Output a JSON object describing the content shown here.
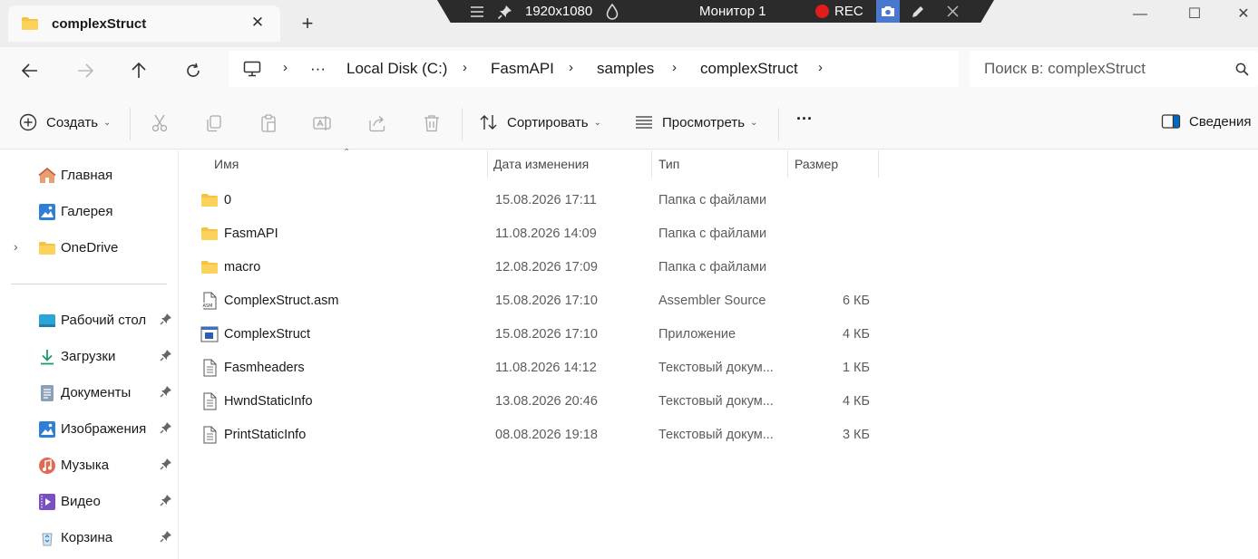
{
  "titlebar": {
    "tab_title": "complexStruct",
    "close_glyph": "✕",
    "new_tab_glyph": "+"
  },
  "overlay": {
    "resolution": "1920x1080",
    "monitor": "Монитор 1",
    "rec": "REC"
  },
  "window_controls": {
    "minimize": "—",
    "maximize": "☐",
    "close": "✕"
  },
  "address": {
    "more": "···",
    "crumbs": [
      "Local Disk (C:)",
      "FasmAPI",
      "samples",
      "complexStruct"
    ],
    "separator": "›"
  },
  "search": {
    "placeholder": "Поиск в: complexStruct"
  },
  "toolbar": {
    "new_label": "Создать",
    "sort_label": "Сортировать",
    "view_label": "Просмотреть",
    "more_label": "···",
    "details_label": "Сведения",
    "caret": "⌄"
  },
  "sidebar": {
    "items": [
      {
        "label": "Главная",
        "icon": "home-icon"
      },
      {
        "label": "Галерея",
        "icon": "gallery-icon"
      },
      {
        "label": "OneDrive",
        "icon": "folder-icon"
      },
      {
        "label": "Рабочий стол",
        "icon": "desktop-icon"
      },
      {
        "label": "Загрузки",
        "icon": "download-icon"
      },
      {
        "label": "Документы",
        "icon": "documents-icon"
      },
      {
        "label": "Изображения",
        "icon": "pictures-icon"
      },
      {
        "label": "Музыка",
        "icon": "music-icon"
      },
      {
        "label": "Видео",
        "icon": "video-icon"
      },
      {
        "label": "Корзина",
        "icon": "recycle-bin-icon"
      }
    ],
    "expand_glyph": "›"
  },
  "columns": {
    "name": "Имя",
    "date": "Дата изменения",
    "type": "Тип",
    "size": "Размер",
    "sort_glyph": "⌃"
  },
  "files": [
    {
      "name": "0",
      "date": "15.08.2026 17:11",
      "type": "Папка с файлами",
      "size": "",
      "icon": "folder-icon"
    },
    {
      "name": "FasmAPI",
      "date": "11.08.2026 14:09",
      "type": "Папка с файлами",
      "size": "",
      "icon": "folder-icon"
    },
    {
      "name": "macro",
      "date": "12.08.2026 17:09",
      "type": "Папка с файлами",
      "size": "",
      "icon": "folder-icon"
    },
    {
      "name": "ComplexStruct.asm",
      "date": "15.08.2026 17:10",
      "type": "Assembler Source",
      "size": "6 КБ",
      "icon": "asm-file-icon"
    },
    {
      "name": "ComplexStruct",
      "date": "15.08.2026 17:10",
      "type": "Приложение",
      "size": "4 КБ",
      "icon": "application-icon"
    },
    {
      "name": "Fasmheaders",
      "date": "11.08.2026 14:12",
      "type": "Текстовый докум...",
      "size": "1 КБ",
      "icon": "text-file-icon"
    },
    {
      "name": "HwndStaticInfo",
      "date": "13.08.2026 20:46",
      "type": "Текстовый докум...",
      "size": "4 КБ",
      "icon": "text-file-icon"
    },
    {
      "name": "PrintStaticInfo",
      "date": "08.08.2026 19:18",
      "type": "Текстовый докум...",
      "size": "3 КБ",
      "icon": "text-file-icon"
    }
  ],
  "colors": {
    "folder": "#f5c242",
    "accent": "#0067c0",
    "rec": "#e21b1b",
    "camera": "#4a78d0"
  }
}
